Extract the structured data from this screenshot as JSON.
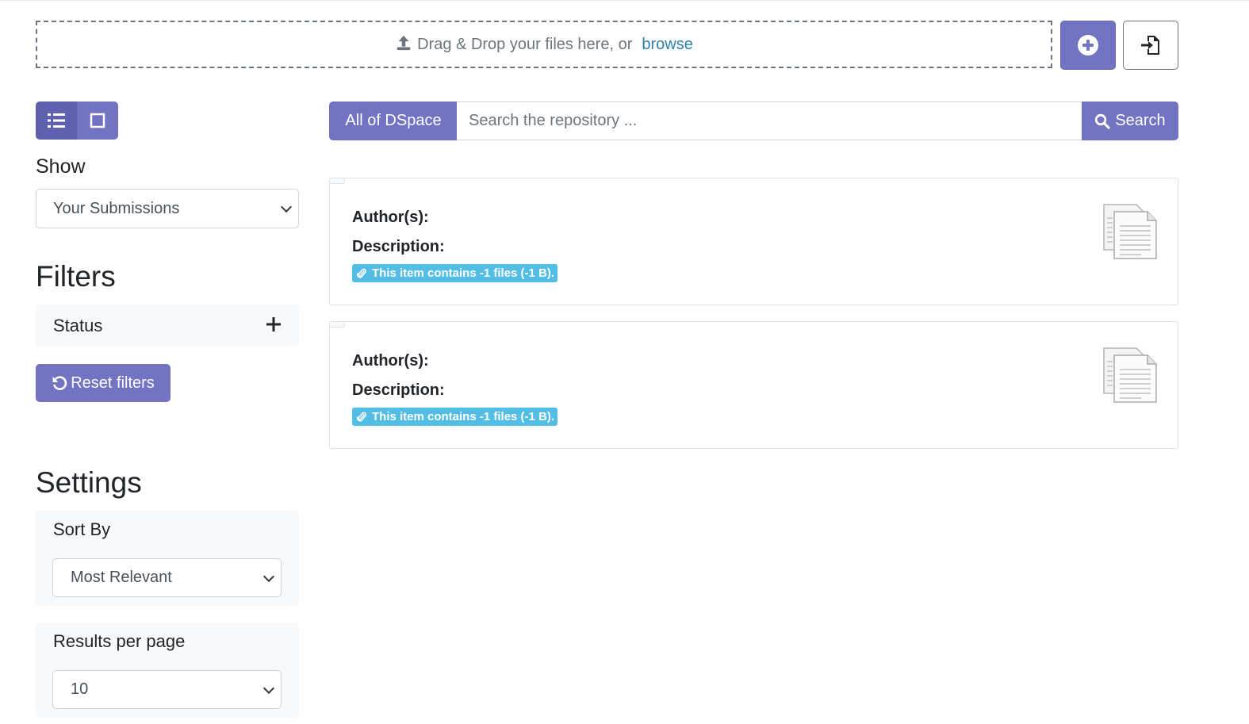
{
  "upload": {
    "drop_text": "Drag & Drop your files here, or",
    "browse_label": "browse"
  },
  "sidebar": {
    "show_label": "Show",
    "show_value": "Your Submissions",
    "filters_heading": "Filters",
    "filter_status_label": "Status",
    "reset_label": "Reset filters",
    "settings_heading": "Settings",
    "sort_label": "Sort By",
    "sort_value": "Most Relevant",
    "rpp_label": "Results per page",
    "rpp_value": "10"
  },
  "search": {
    "scope_label": "All of DSpace",
    "placeholder": "Search the repository ...",
    "button_label": "Search"
  },
  "results": [
    {
      "author_label": "Author(s):",
      "description_label": "Description:",
      "badge_text": "This item contains -1 files (-1 B)."
    },
    {
      "author_label": "Author(s):",
      "description_label": "Description:",
      "badge_text": "This item contains -1 files (-1 B)."
    }
  ],
  "colors": {
    "primary": "#7273c2",
    "badge": "#52bde5",
    "link": "#2b7fa8"
  },
  "icons": [
    "upload-icon",
    "plus-circle-icon",
    "file-import-icon",
    "list-view-icon",
    "grid-view-icon",
    "plus-icon",
    "undo-icon",
    "search-icon",
    "paperclip-icon",
    "document-thumbnail-icon"
  ]
}
